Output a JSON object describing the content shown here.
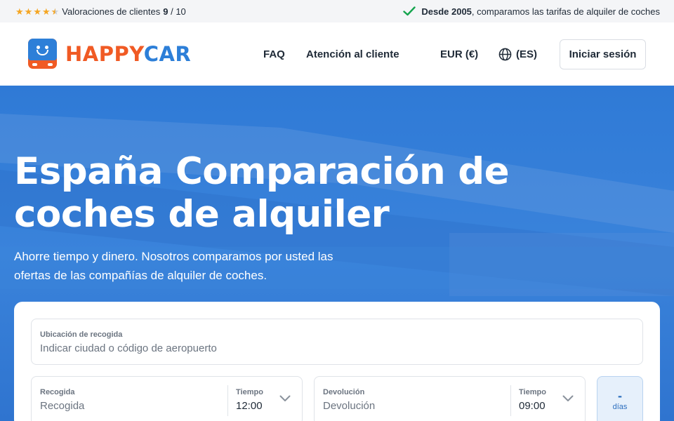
{
  "topbar": {
    "rating_text": "Valoraciones de clientes",
    "rating_score": "9",
    "rating_separator": " / ",
    "rating_max": "10",
    "since_bold": "Desde 2005",
    "since_text": ", comparamos las tarifas de alquiler de coches",
    "rating_stars": 4.5
  },
  "header": {
    "logo_happy": "HAPPY",
    "logo_car": "CAR",
    "nav": {
      "faq": "FAQ",
      "support": "Atención al cliente",
      "currency": "EUR (€)",
      "language": "(ES)"
    },
    "login": "Iniciar sesión"
  },
  "hero": {
    "title": "España Comparación de coches de alquiler",
    "subtitle": "Ahorre tiempo y dinero. Nosotros comparamos por usted las ofertas de las compañías de alquiler de coches."
  },
  "search": {
    "location_label": "Ubicación de recogida",
    "location_placeholder": "Indicar ciudad o código de aeropuerto",
    "pickup_label": "Recogida",
    "pickup_value": "Recogida",
    "pickup_time_label": "Tiempo",
    "pickup_time": "12:00",
    "return_label": "Devolución",
    "return_value": "Devolución",
    "return_time_label": "Tiempo",
    "return_time": "09:00",
    "days_value": "-",
    "days_label": "días"
  },
  "colors": {
    "brand_orange": "#f05a24",
    "brand_blue": "#2d7fd8",
    "hero_blue": "#2f7ad6",
    "check_green": "#14a44d",
    "star": "#f5a623"
  },
  "icons": [
    "star-icon",
    "check-icon",
    "globe-icon",
    "chevron-down-icon",
    "logo-car-icon"
  ]
}
